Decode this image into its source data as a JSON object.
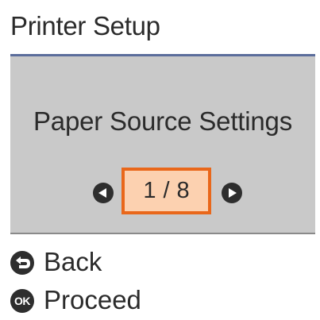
{
  "header": {
    "title": "Printer Setup"
  },
  "panel": {
    "title": "Paper Source Settings",
    "pager": {
      "current": "1",
      "separator": "/",
      "total": "8",
      "prev_icon": "left-arrow-icon",
      "next_icon": "right-arrow-icon"
    }
  },
  "footer": {
    "back": {
      "icon": "back-icon",
      "label": "Back"
    },
    "proceed": {
      "icon": "ok-icon",
      "icon_text": "OK",
      "label": "Proceed"
    }
  },
  "colors": {
    "accent": "#e9671a",
    "page_box_fill": "#fcd1b0",
    "header_rule": "#5b6d9b",
    "panel_background": "#c9c9c9",
    "icon_fill": "#2e2e2e"
  }
}
